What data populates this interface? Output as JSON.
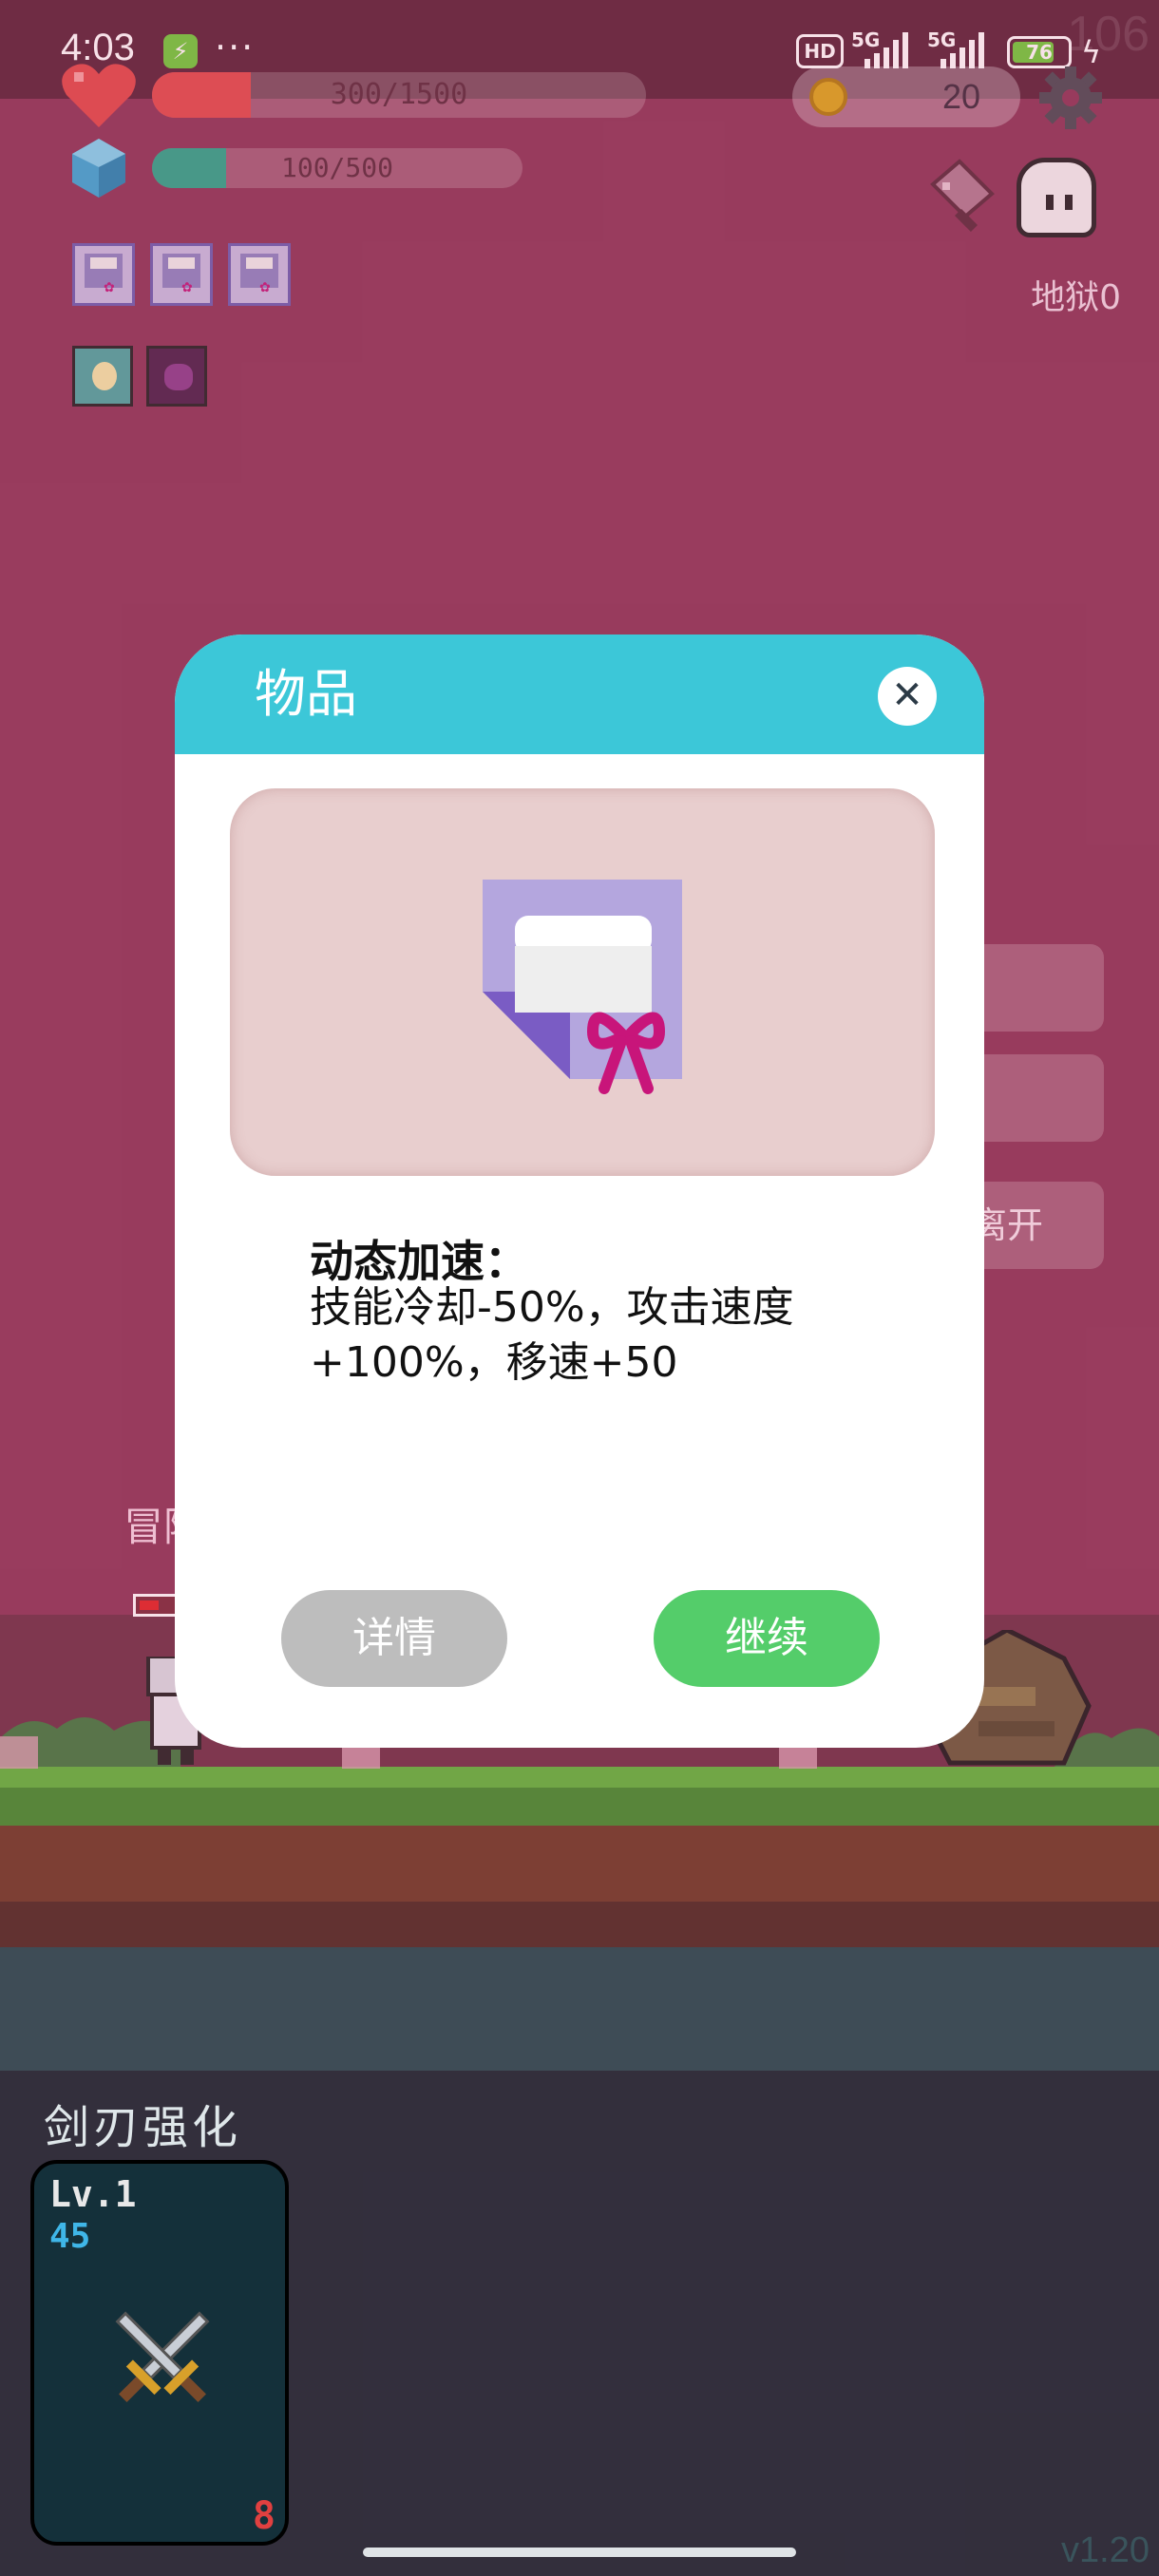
{
  "status_bar": {
    "time": "4:03",
    "more": "···",
    "hd": "HD",
    "net1": "5G",
    "net2": "5G",
    "battery": "76",
    "battery_level": 0.76,
    "corner_number": "106"
  },
  "hud": {
    "hp_text": "300/1500",
    "hp_fraction": 0.2,
    "mp_text": "100/500",
    "mp_fraction": 0.2,
    "coins": "20",
    "hell_label": "地狱0"
  },
  "side_buttons": [
    "",
    "",
    "离开"
  ],
  "scene": {
    "adventurer_label": "冒险"
  },
  "dialog": {
    "title": "物品",
    "close_symbol": "✕",
    "item_name": "动态加速：",
    "item_effect": "技能冷却-50%，攻击速度+100%，移速+50",
    "details_button": "详情",
    "continue_button": "继续"
  },
  "skills": {
    "title": "剑刃强化",
    "level": "Lv.1",
    "cost": "45",
    "count": "8"
  },
  "footer": {
    "version": "v1.20"
  },
  "colors": {
    "header_accent": "#3cc7d8",
    "continue_green": "#54cd6a",
    "details_gray": "#bdbdbd",
    "hp_red": "#e04b4b",
    "mp_teal": "#2aa78a"
  },
  "icons": [
    "heart-icon",
    "crystal-icon",
    "coin-icon",
    "gear-icon",
    "cleaver-icon",
    "ghost-icon",
    "gift-scroll-icon",
    "crossed-swords-icon"
  ]
}
